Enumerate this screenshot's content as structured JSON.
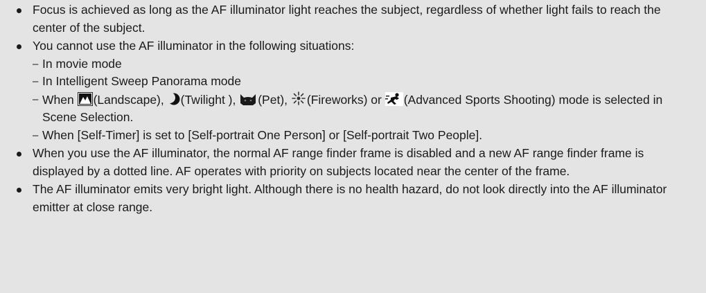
{
  "notes": [
    {
      "text": "Focus is achieved as long as the AF illuminator light reaches the subject, regardless of whether light fails to reach the center of the subject."
    },
    {
      "text": "You cannot use the AF illuminator in the following situations:",
      "sub": [
        "In movie mode",
        "In Intelligent Sweep Panorama mode",
        {
          "when": "When",
          "landscape": "(Landscape),",
          "twilight": "(Twilight ),",
          "pet": "(Pet),",
          "fireworks": "(Fireworks) or",
          "sports": "(Advanced Sports Shooting) mode is selected in Scene Selection."
        },
        "When [Self-Timer] is set to [Self-portrait One Person] or [Self-portrait Two People]."
      ]
    },
    {
      "text": "When you use the AF illuminator, the normal AF range finder frame is disabled and a new AF range finder frame is displayed by a dotted line. AF operates with priority on subjects located near the center of the frame."
    },
    {
      "text": "The AF illuminator emits very bright light. Although there is no health hazard, do not look directly into the AF illuminator emitter at close range."
    }
  ],
  "icons": {
    "landscape": "landscape-icon",
    "twilight": "twilight-icon",
    "pet": "pet-icon",
    "fireworks": "fireworks-icon",
    "sports": "advanced-sports-icon"
  },
  "dash_glyph": "–"
}
